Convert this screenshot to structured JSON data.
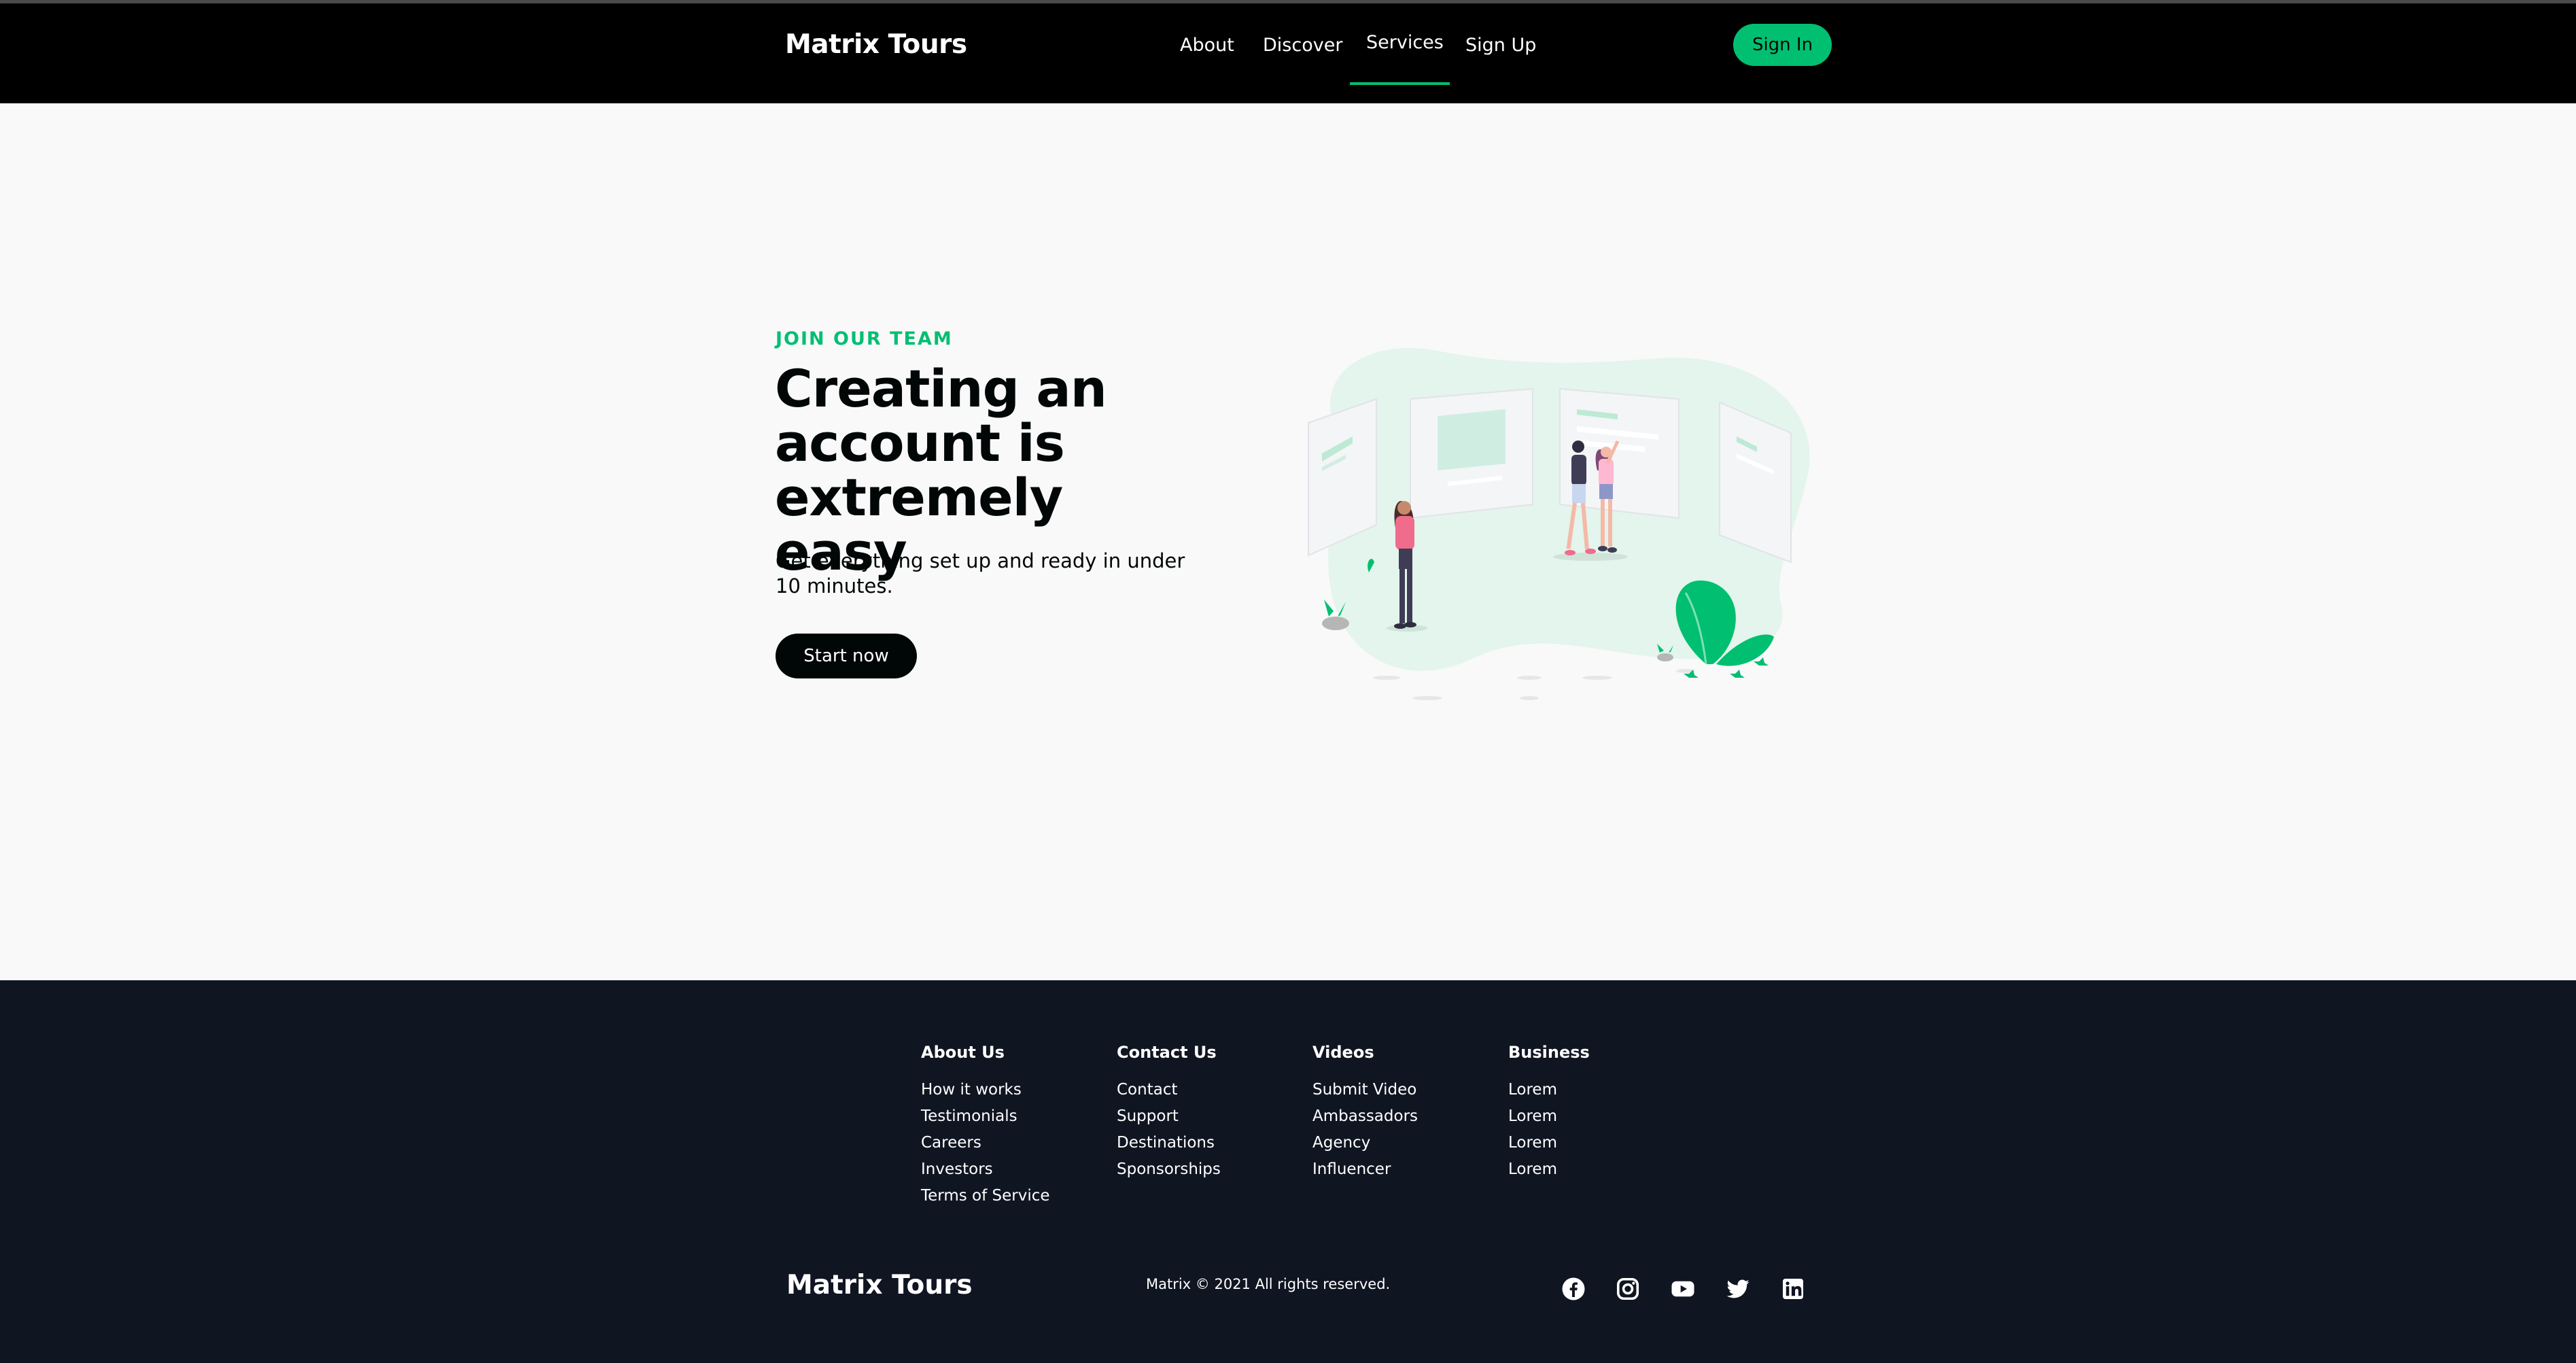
{
  "nav": {
    "logo": "Matrix Tours",
    "links": [
      "About",
      "Discover",
      "Services",
      "Sign Up"
    ],
    "active_link": "Services",
    "signin_label": "Sign In"
  },
  "hero": {
    "eyebrow": "JOIN OUR TEAM",
    "headline": "Creating an account is extremely easy",
    "subtext": "Get everything set up and ready in under 10 minutes.",
    "cta_label": "Start now",
    "illustration_icon": "people-viewing-boards-illustration"
  },
  "footer": {
    "columns": [
      {
        "heading": "About Us",
        "links": [
          "How it works",
          "Testimonials",
          "Careers",
          "Investors",
          "Terms of Service"
        ]
      },
      {
        "heading": "Contact Us",
        "links": [
          "Contact",
          "Support",
          "Destinations",
          "Sponsorships"
        ]
      },
      {
        "heading": "Videos",
        "links": [
          "Submit Video",
          "Ambassadors",
          "Agency",
          "Influencer"
        ]
      },
      {
        "heading": "Business",
        "links": [
          "Lorem",
          "Lorem",
          "Lorem",
          "Lorem"
        ]
      }
    ],
    "logo": "Matrix Tours",
    "copyright": "Matrix © 2021 All rights reserved.",
    "social": [
      "facebook-icon",
      "instagram-icon",
      "youtube-icon",
      "twitter-icon",
      "linkedin-icon"
    ]
  },
  "colors": {
    "accent": "#01bf71",
    "nav_bg": "#000000",
    "hero_bg": "#f9f9f9",
    "footer_bg": "#101522",
    "dark_text": "#010606"
  }
}
